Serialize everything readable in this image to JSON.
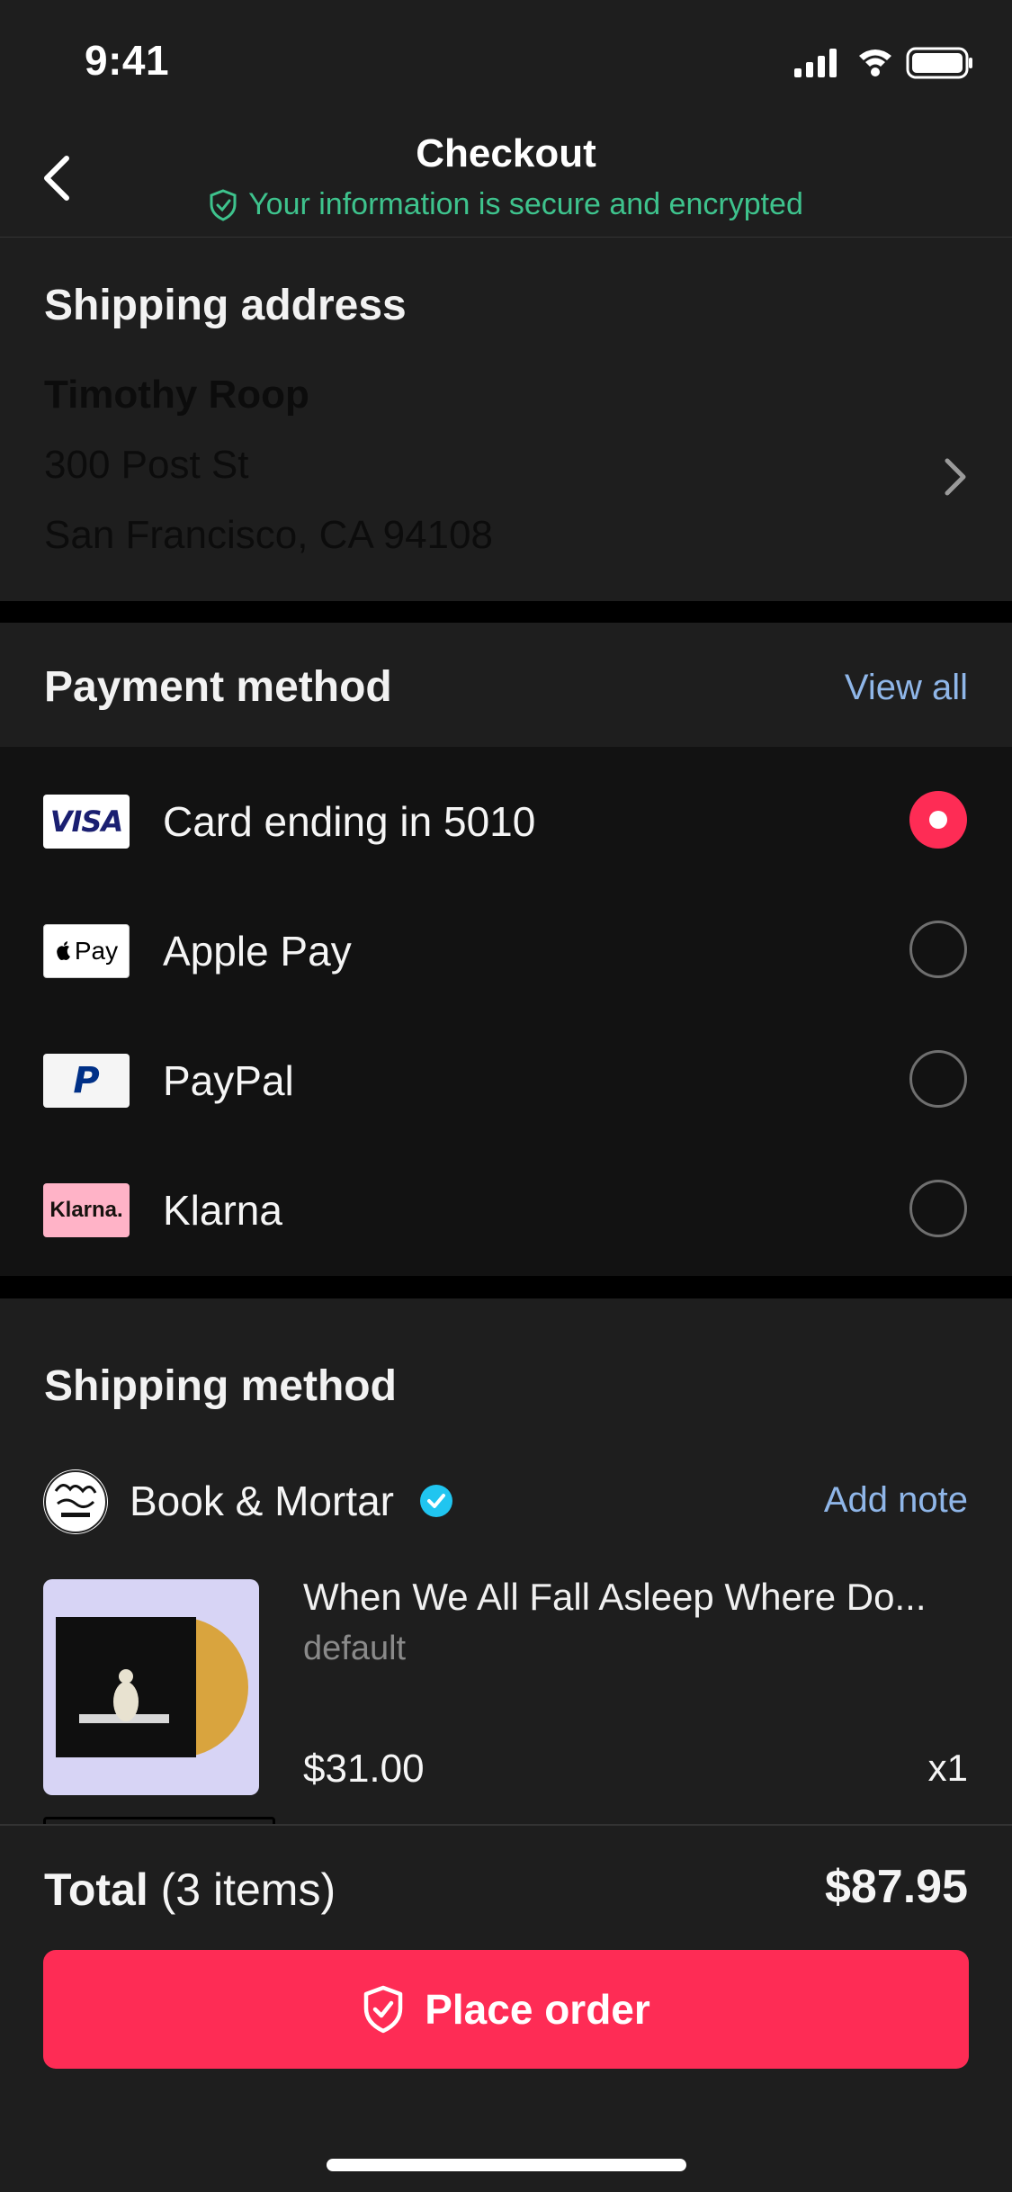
{
  "status_bar": {
    "time": "9:41",
    "icons": [
      "signal-icon",
      "wifi-icon",
      "battery-icon"
    ]
  },
  "nav": {
    "title": "Checkout",
    "secure_text": "Your information is secure and encrypted",
    "back_icon": "chevron-left-icon",
    "secure_icon": "shield-check-icon"
  },
  "shipping_address": {
    "title": "Shipping address",
    "name": "Timothy Roop",
    "street": "300 Post St",
    "city": "San Francisco, CA 94108"
  },
  "payment": {
    "title": "Payment method",
    "view_all": "View all",
    "methods": [
      {
        "logo": "VISA",
        "label": "Card ending in 5010",
        "selected": true
      },
      {
        "logo": "Pay",
        "label": "Apple Pay",
        "selected": false
      },
      {
        "logo": "P",
        "label": "PayPal",
        "selected": false
      },
      {
        "logo": "Klarna.",
        "label": "Klarna",
        "selected": false
      }
    ]
  },
  "shipping_method": {
    "title": "Shipping method",
    "seller": "Book & Mortar",
    "add_note": "Add note",
    "product": {
      "title": "When We All Fall Asleep Where Do...",
      "variant": "default",
      "price": "$31.00",
      "quantity": "x1"
    }
  },
  "footer": {
    "total_label": "Total",
    "total_items": "(3 items)",
    "total_value": "$87.95",
    "place_order": "Place order"
  },
  "colors": {
    "accent": "#fe2c55",
    "link": "#8fb6e8",
    "secure": "#3ec38d",
    "background": "#1e1e1e"
  }
}
